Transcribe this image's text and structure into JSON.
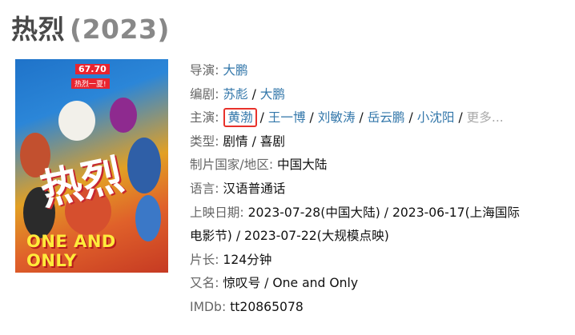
{
  "header": {
    "title": "热烈",
    "year": "(2023)"
  },
  "poster": {
    "tag_top": "67.70",
    "tag_sub": "热烈一夏!",
    "cn_title": "热烈",
    "en_title": "ONE AND ONLY"
  },
  "info": {
    "director": {
      "label": "导演",
      "colon": ": ",
      "values": [
        "大鹏"
      ]
    },
    "writer": {
      "label": "编剧",
      "colon": ": ",
      "values": [
        "苏彪",
        "大鹏"
      ]
    },
    "cast": {
      "label": "主演",
      "colon": ": ",
      "values": [
        "黄渤",
        "王一博",
        "刘敏涛",
        "岳云鹏",
        "小沈阳"
      ],
      "more": "更多..."
    },
    "genre": {
      "label": "类型",
      "colon": ": ",
      "values": [
        "剧情",
        "喜剧"
      ]
    },
    "country": {
      "label": "制片国家/地区",
      "colon": ": ",
      "value": "中国大陆"
    },
    "language": {
      "label": "语言",
      "colon": ": ",
      "value": "汉语普通话"
    },
    "release": {
      "label": "上映日期",
      "colon": ": ",
      "line1": "2023-07-28(中国大陆) / 2023-06-17(上海国际",
      "line2": "电影节) / 2023-07-22(大规模点映)"
    },
    "runtime": {
      "label": "片长",
      "colon": ": ",
      "value": "124分钟"
    },
    "aka": {
      "label": "又名",
      "colon": ": ",
      "value": "惊叹号 / One and Only"
    },
    "imdb": {
      "label": "IMDb",
      "colon": ": ",
      "value": "tt20865078"
    }
  },
  "colors": {
    "link": "#3377aa",
    "label": "#666666",
    "highlight_border": "#e8322b",
    "more": "#aaaaaa"
  }
}
